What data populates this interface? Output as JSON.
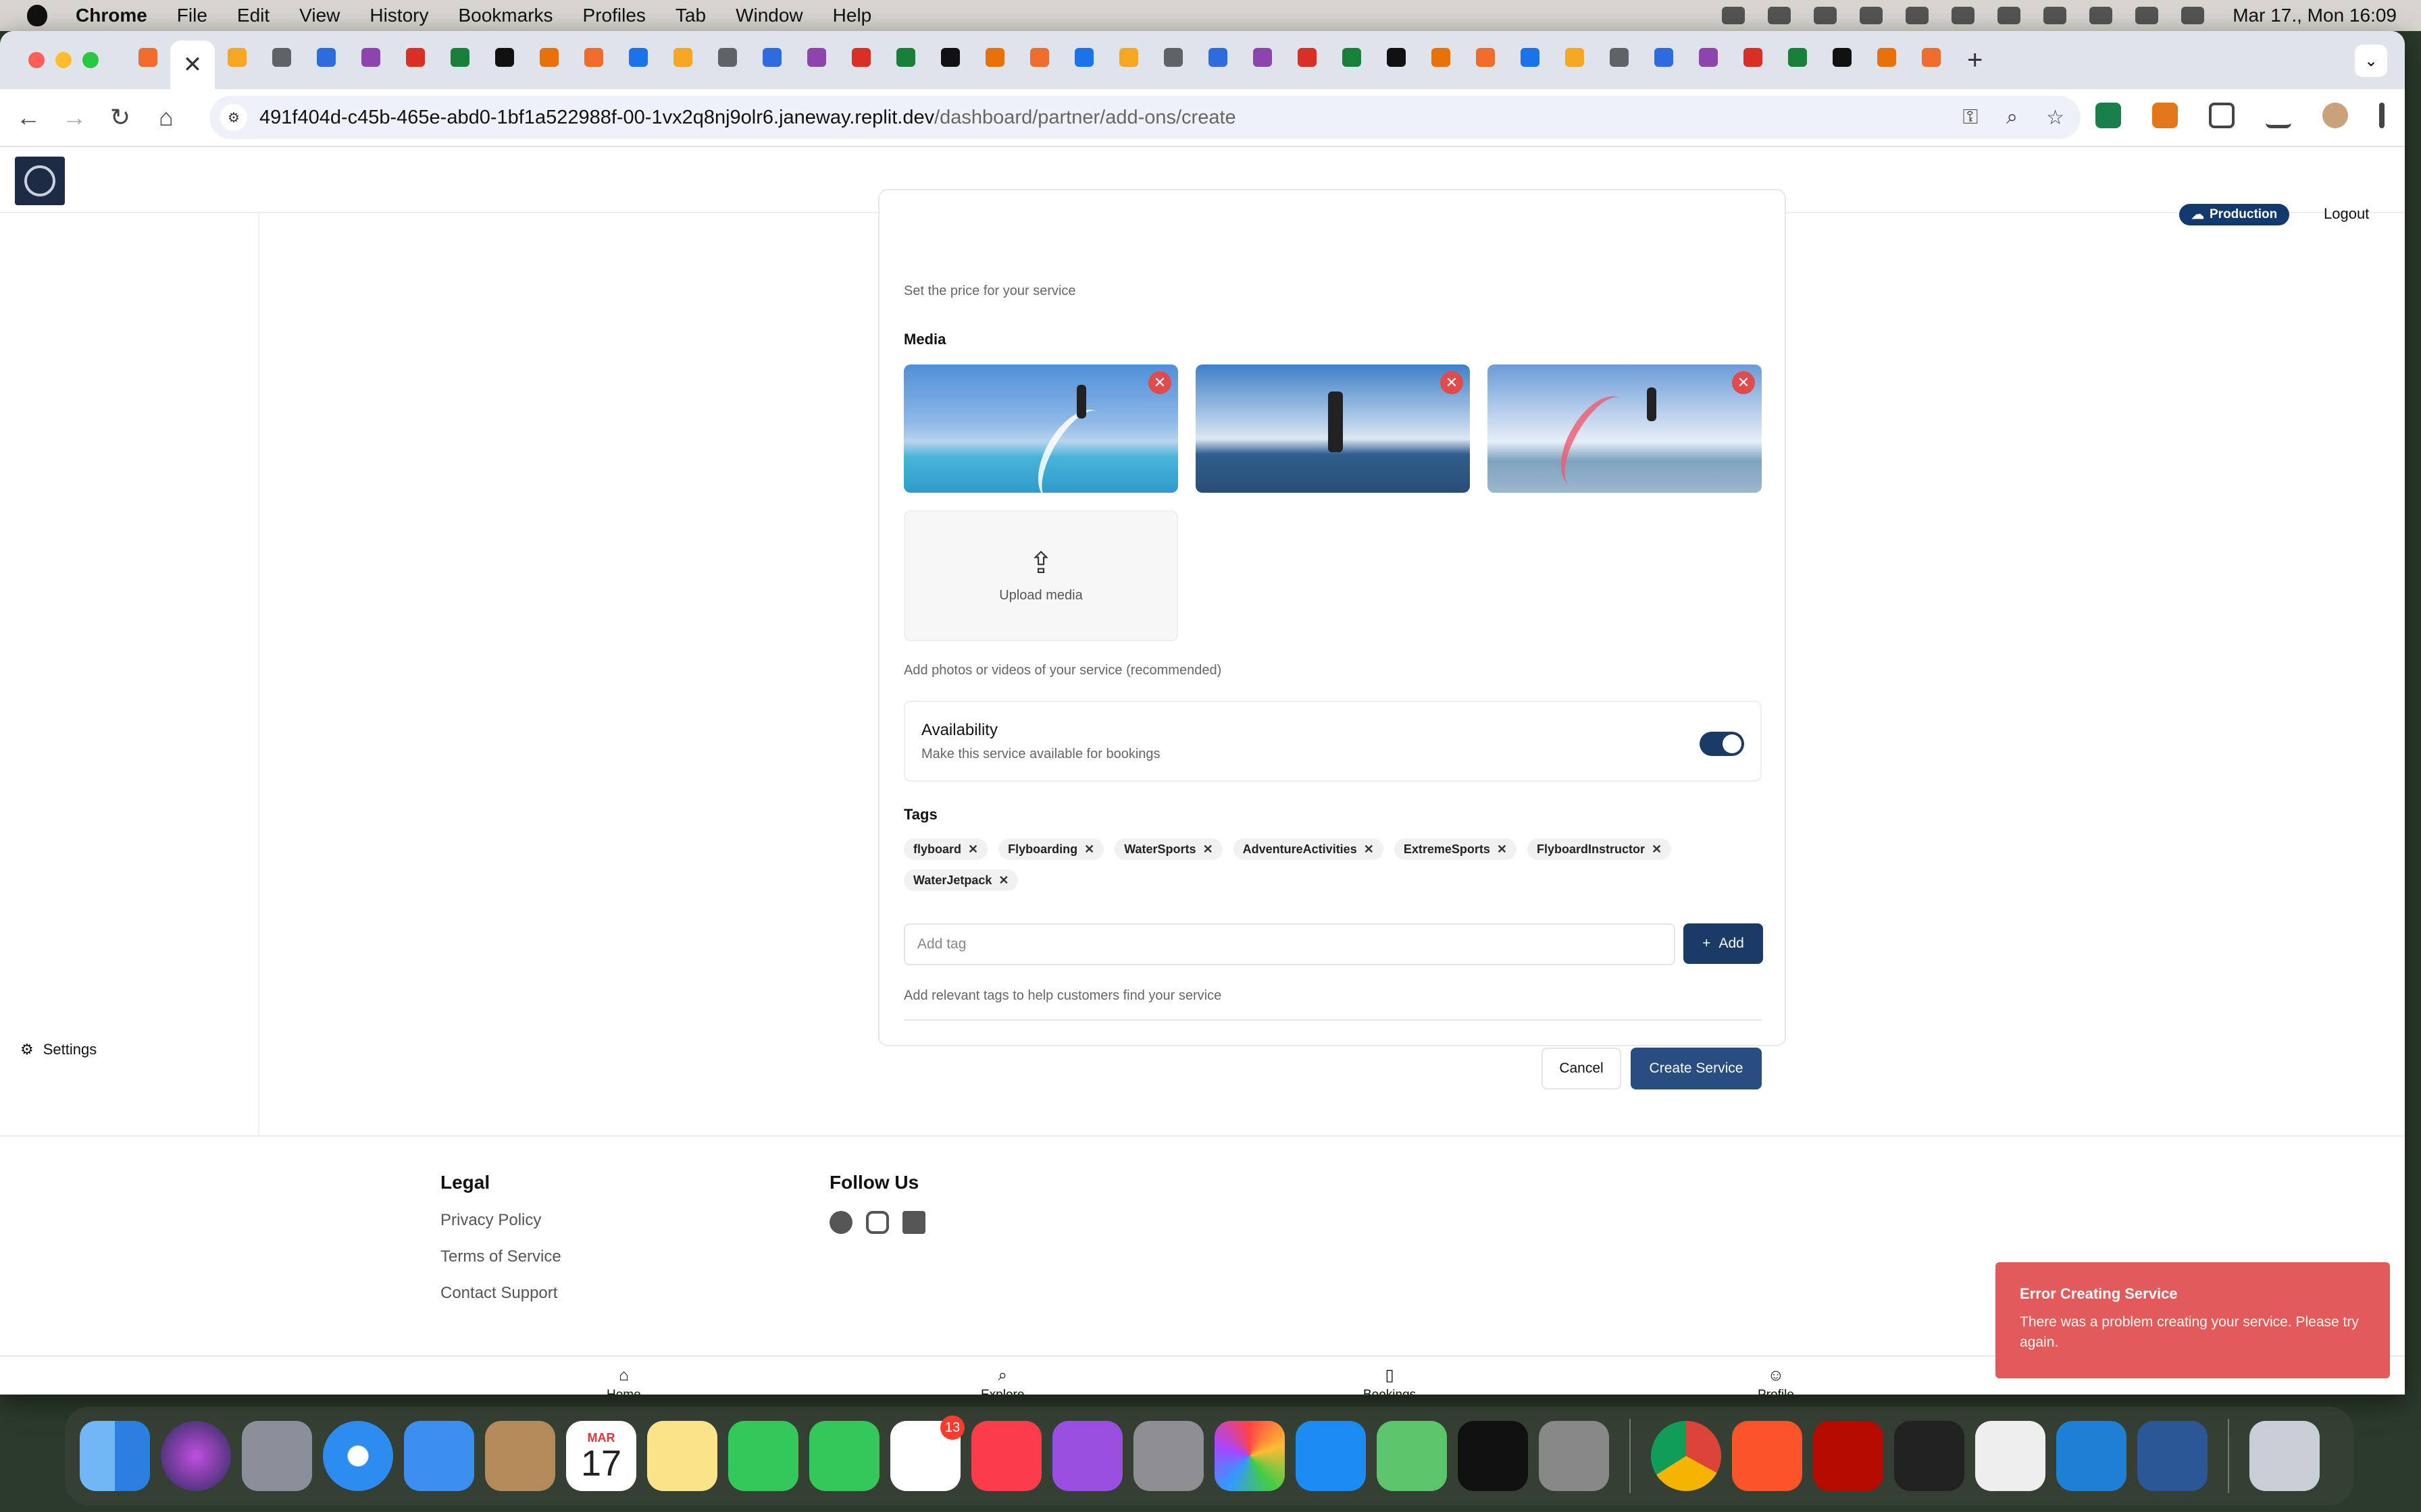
{
  "menubar": {
    "app_name": "Chrome",
    "items": [
      "File",
      "Edit",
      "View",
      "History",
      "Bookmarks",
      "Profiles",
      "Tab",
      "Window",
      "Help"
    ],
    "clock": "Mar 17., Mon  16:09"
  },
  "browser": {
    "url_host": "491f404d-c45b-465e-abd0-1bf1a522988f-00-1vx2q8nj9olr6.janeway.replit.dev",
    "url_path": "/dashboard/partner/add-ons/create",
    "tab_count": 41
  },
  "header": {
    "env_badge": "Production",
    "logout_label": "Logout"
  },
  "sidebar": {
    "settings_label": "Settings"
  },
  "form": {
    "price_hint": "Set the price for your service",
    "media_label": "Media",
    "upload_label": "Upload media",
    "media_hint": "Add photos or videos of your service (recommended)",
    "availability_title": "Availability",
    "availability_desc": "Make this service available for bookings",
    "availability_enabled": true,
    "tags_label": "Tags",
    "tags": [
      "flyboard",
      "Flyboarding",
      "WaterSports",
      "AdventureActivities",
      "ExtremeSports",
      "FlyboardInstructor",
      "WaterJetpack"
    ],
    "tag_placeholder": "Add tag",
    "add_button": "Add",
    "tags_hint": "Add relevant tags to help customers find your service",
    "cancel_button": "Cancel",
    "create_button": "Create Service"
  },
  "footer": {
    "legal_title": "Legal",
    "legal_links": [
      "Privacy Policy",
      "Terms of Service",
      "Contact Support"
    ],
    "follow_title": "Follow Us",
    "social_icons": [
      "facebook-icon",
      "instagram-icon",
      "linkedin-icon"
    ]
  },
  "bottom_nav": {
    "home": "Home",
    "explore": "Explore",
    "bookings": "Bookings",
    "profile": "Profile"
  },
  "toast": {
    "title": "Error Creating Service",
    "description": "There was a problem creating your service. Please try again."
  },
  "dock": {
    "calendar_month": "MAR",
    "calendar_day": "17",
    "reminders_badge": "13"
  },
  "colors": {
    "primary": "#284d80",
    "toggle_on": "#1c3a66",
    "error_toast": "#e35a5a",
    "remove_button": "#e04b4b"
  }
}
